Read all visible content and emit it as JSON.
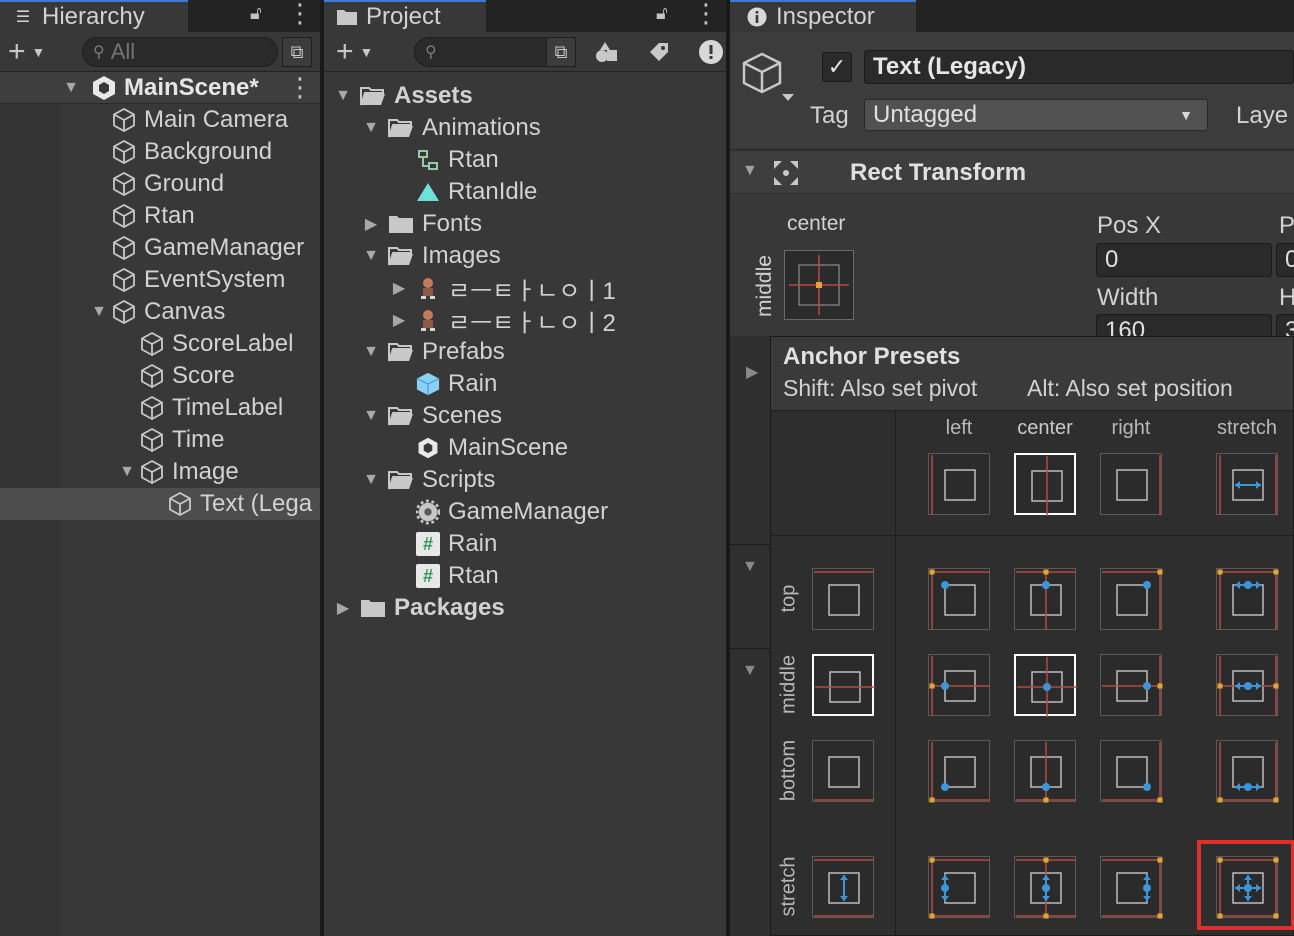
{
  "hierarchy": {
    "tab_title": "Hierarchy",
    "search_placeholder": "All",
    "scene_name": "MainScene*",
    "items": [
      {
        "label": "Main Camera",
        "depth": 1,
        "expanded": null,
        "selected": false
      },
      {
        "label": "Background",
        "depth": 1,
        "expanded": null,
        "selected": false
      },
      {
        "label": "Ground",
        "depth": 1,
        "expanded": null,
        "selected": false
      },
      {
        "label": "Rtan",
        "depth": 1,
        "expanded": null,
        "selected": false
      },
      {
        "label": "GameManager",
        "depth": 1,
        "expanded": null,
        "selected": false
      },
      {
        "label": "EventSystem",
        "depth": 1,
        "expanded": null,
        "selected": false
      },
      {
        "label": "Canvas",
        "depth": 1,
        "expanded": true,
        "selected": false
      },
      {
        "label": "ScoreLabel",
        "depth": 2,
        "expanded": null,
        "selected": false
      },
      {
        "label": "Score",
        "depth": 2,
        "expanded": null,
        "selected": false
      },
      {
        "label": "TimeLabel",
        "depth": 2,
        "expanded": null,
        "selected": false
      },
      {
        "label": "Time",
        "depth": 2,
        "expanded": null,
        "selected": false
      },
      {
        "label": "Image",
        "depth": 2,
        "expanded": true,
        "selected": false
      },
      {
        "label": "Text (Lega",
        "depth": 3,
        "expanded": null,
        "selected": true
      }
    ]
  },
  "project": {
    "tab_title": "Project",
    "items": [
      {
        "label": "Assets",
        "depth": 0,
        "kind": "folder-open",
        "expanded": true,
        "bold": true
      },
      {
        "label": "Animations",
        "depth": 1,
        "kind": "folder-open",
        "expanded": true,
        "bold": false
      },
      {
        "label": "Rtan",
        "depth": 2,
        "kind": "animator",
        "expanded": null,
        "bold": false
      },
      {
        "label": "RtanIdle",
        "depth": 2,
        "kind": "anim-clip",
        "expanded": null,
        "bold": false
      },
      {
        "label": "Fonts",
        "depth": 1,
        "kind": "folder",
        "expanded": false,
        "bold": false
      },
      {
        "label": "Images",
        "depth": 1,
        "kind": "folder-open",
        "expanded": true,
        "bold": false
      },
      {
        "label": "ㄹㅡㅌㅏㄴㅇㅣ1",
        "depth": 2,
        "kind": "sprite",
        "expanded": false,
        "bold": false
      },
      {
        "label": "ㄹㅡㅌㅏㄴㅇㅣ2",
        "depth": 2,
        "kind": "sprite",
        "expanded": false,
        "bold": false
      },
      {
        "label": "Prefabs",
        "depth": 1,
        "kind": "folder-open",
        "expanded": true,
        "bold": false
      },
      {
        "label": "Rain",
        "depth": 2,
        "kind": "prefab",
        "expanded": null,
        "bold": false
      },
      {
        "label": "Scenes",
        "depth": 1,
        "kind": "folder-open",
        "expanded": true,
        "bold": false
      },
      {
        "label": "MainScene",
        "depth": 2,
        "kind": "scene",
        "expanded": null,
        "bold": false
      },
      {
        "label": "Scripts",
        "depth": 1,
        "kind": "folder-open",
        "expanded": true,
        "bold": false
      },
      {
        "label": "GameManager",
        "depth": 2,
        "kind": "gear",
        "expanded": null,
        "bold": false
      },
      {
        "label": "Rain",
        "depth": 2,
        "kind": "script",
        "expanded": null,
        "bold": false
      },
      {
        "label": "Rtan",
        "depth": 2,
        "kind": "script",
        "expanded": null,
        "bold": false
      },
      {
        "label": "Packages",
        "depth": 0,
        "kind": "folder",
        "expanded": false,
        "bold": true
      }
    ]
  },
  "inspector": {
    "tab_title": "Inspector",
    "object_name": "Text (Legacy)",
    "active": true,
    "tag_label": "Tag",
    "tag_value": "Untagged",
    "layer_label": "Laye",
    "component_title": "Rect Transform",
    "anchor_h": "center",
    "anchor_v": "middle",
    "pos_x_label": "Pos X",
    "pos_x_value": "0",
    "pos_y_label": "P",
    "pos_y_value": "0",
    "width_label": "Width",
    "width_value": "160",
    "height_label": "H",
    "height_value": "3"
  },
  "anchor_presets": {
    "title": "Anchor Presets",
    "hint_shift": "Shift: Also set pivot",
    "hint_alt": "Alt: Also set position",
    "columns": [
      "left",
      "center",
      "right",
      "stretch"
    ],
    "rows": [
      "top",
      "middle",
      "bottom",
      "stretch"
    ],
    "selected_h": "center",
    "selected_v": "middle",
    "highlighted": "stretch-stretch"
  },
  "colors": {
    "accent_highlight": "#e0302a",
    "anchor_red": "#b54a3f",
    "anchor_blue": "#3a96d8",
    "anchor_gold": "#e0a533"
  }
}
